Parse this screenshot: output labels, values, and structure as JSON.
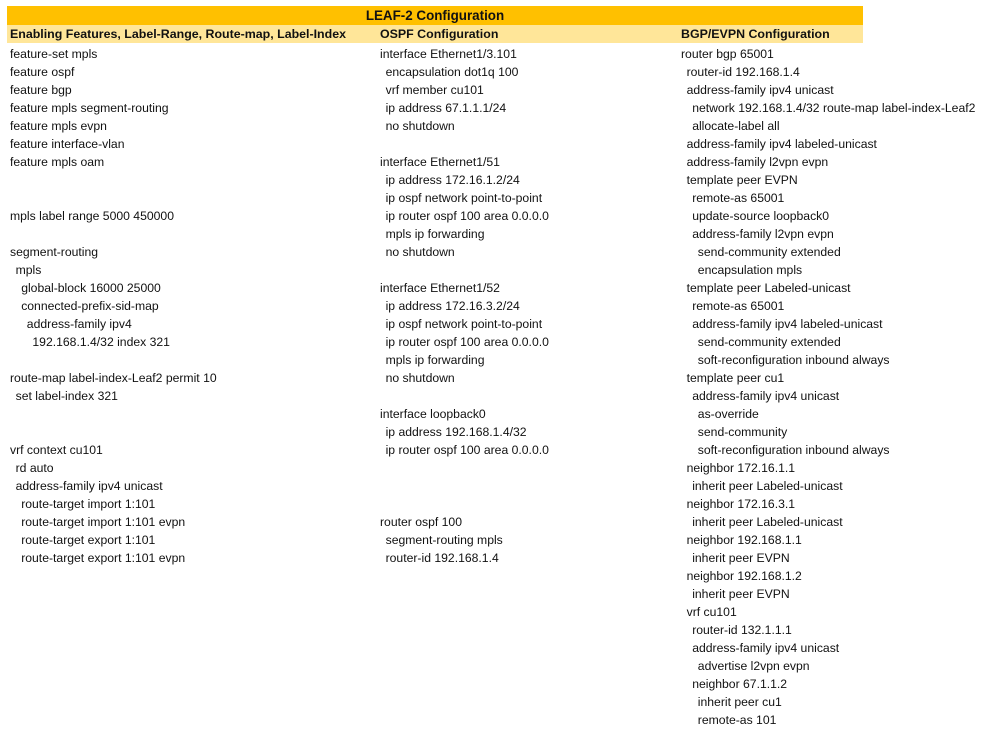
{
  "title": "LEAF-2 Configuration",
  "colors": {
    "title_bg": "#ffc000",
    "header_bg": "#ffe699"
  },
  "columns": [
    {
      "header": "Enabling Features, Label-Range, Route-map, Label-Index",
      "lines": [
        {
          "indent": 0,
          "text": "feature-set mpls"
        },
        {
          "indent": 0,
          "text": "feature ospf"
        },
        {
          "indent": 0,
          "text": "feature bgp"
        },
        {
          "indent": 0,
          "text": "feature mpls segment-routing"
        },
        {
          "indent": 0,
          "text": "feature mpls evpn"
        },
        {
          "indent": 0,
          "text": "feature interface-vlan"
        },
        {
          "indent": 0,
          "text": "feature mpls oam"
        },
        {
          "indent": 0,
          "text": ""
        },
        {
          "indent": 0,
          "text": ""
        },
        {
          "indent": 0,
          "text": "mpls label range 5000 450000"
        },
        {
          "indent": 0,
          "text": ""
        },
        {
          "indent": 0,
          "text": "segment-routing"
        },
        {
          "indent": 1,
          "text": "mpls"
        },
        {
          "indent": 2,
          "text": "global-block 16000 25000"
        },
        {
          "indent": 2,
          "text": "connected-prefix-sid-map"
        },
        {
          "indent": 3,
          "text": "address-family ipv4"
        },
        {
          "indent": 4,
          "text": "192.168.1.4/32 index 321"
        },
        {
          "indent": 0,
          "text": ""
        },
        {
          "indent": 0,
          "text": "route-map label-index-Leaf2 permit 10"
        },
        {
          "indent": 1,
          "text": "set label-index 321"
        },
        {
          "indent": 0,
          "text": ""
        },
        {
          "indent": 0,
          "text": ""
        },
        {
          "indent": 0,
          "text": "vrf context cu101"
        },
        {
          "indent": 1,
          "text": "rd auto"
        },
        {
          "indent": 1,
          "text": "address-family ipv4 unicast"
        },
        {
          "indent": 2,
          "text": "route-target import 1:101"
        },
        {
          "indent": 2,
          "text": "route-target import 1:101 evpn"
        },
        {
          "indent": 2,
          "text": "route-target export 1:101"
        },
        {
          "indent": 2,
          "text": "route-target export 1:101 evpn"
        }
      ]
    },
    {
      "header": "OSPF Configuration",
      "lines": [
        {
          "indent": 0,
          "text": "interface Ethernet1/3.101"
        },
        {
          "indent": 1,
          "text": "encapsulation dot1q 100"
        },
        {
          "indent": 1,
          "text": "vrf member cu101"
        },
        {
          "indent": 1,
          "text": "ip address 67.1.1.1/24"
        },
        {
          "indent": 1,
          "text": "no shutdown"
        },
        {
          "indent": 0,
          "text": ""
        },
        {
          "indent": 0,
          "text": "interface Ethernet1/51"
        },
        {
          "indent": 1,
          "text": "ip address 172.16.1.2/24"
        },
        {
          "indent": 1,
          "text": "ip ospf network point-to-point"
        },
        {
          "indent": 1,
          "text": "ip router ospf 100 area 0.0.0.0"
        },
        {
          "indent": 1,
          "text": "mpls ip forwarding"
        },
        {
          "indent": 1,
          "text": "no shutdown"
        },
        {
          "indent": 0,
          "text": ""
        },
        {
          "indent": 0,
          "text": "interface Ethernet1/52"
        },
        {
          "indent": 1,
          "text": "ip address 172.16.3.2/24"
        },
        {
          "indent": 1,
          "text": "ip ospf network point-to-point"
        },
        {
          "indent": 1,
          "text": "ip router ospf 100 area 0.0.0.0"
        },
        {
          "indent": 1,
          "text": "mpls ip forwarding"
        },
        {
          "indent": 1,
          "text": "no shutdown"
        },
        {
          "indent": 0,
          "text": ""
        },
        {
          "indent": 0,
          "text": "interface loopback0"
        },
        {
          "indent": 1,
          "text": "ip address 192.168.1.4/32"
        },
        {
          "indent": 1,
          "text": "ip router ospf 100 area 0.0.0.0"
        },
        {
          "indent": 0,
          "text": ""
        },
        {
          "indent": 0,
          "text": ""
        },
        {
          "indent": 0,
          "text": ""
        },
        {
          "indent": 0,
          "text": "router ospf 100"
        },
        {
          "indent": 1,
          "text": "segment-routing mpls"
        },
        {
          "indent": 1,
          "text": "router-id 192.168.1.4"
        }
      ]
    },
    {
      "header": "BGP/EVPN Configuration",
      "lines": [
        {
          "indent": 0,
          "text": "router bgp 65001"
        },
        {
          "indent": 1,
          "text": "router-id 192.168.1.4"
        },
        {
          "indent": 1,
          "text": "address-family ipv4 unicast"
        },
        {
          "indent": 2,
          "text": "network 192.168.1.4/32 route-map label-index-Leaf2"
        },
        {
          "indent": 2,
          "text": "allocate-label all"
        },
        {
          "indent": 1,
          "text": "address-family ipv4 labeled-unicast"
        },
        {
          "indent": 1,
          "text": "address-family l2vpn evpn"
        },
        {
          "indent": 1,
          "text": "template peer EVPN"
        },
        {
          "indent": 2,
          "text": "remote-as 65001"
        },
        {
          "indent": 2,
          "text": "update-source loopback0"
        },
        {
          "indent": 2,
          "text": "address-family l2vpn evpn"
        },
        {
          "indent": 3,
          "text": "send-community extended"
        },
        {
          "indent": 3,
          "text": "encapsulation mpls"
        },
        {
          "indent": 1,
          "text": "template peer Labeled-unicast"
        },
        {
          "indent": 2,
          "text": "remote-as 65001"
        },
        {
          "indent": 2,
          "text": "address-family ipv4 labeled-unicast"
        },
        {
          "indent": 3,
          "text": "send-community extended"
        },
        {
          "indent": 3,
          "text": "soft-reconfiguration inbound always"
        },
        {
          "indent": 1,
          "text": "template peer cu1"
        },
        {
          "indent": 2,
          "text": "address-family ipv4 unicast"
        },
        {
          "indent": 3,
          "text": "as-override"
        },
        {
          "indent": 3,
          "text": "send-community"
        },
        {
          "indent": 3,
          "text": "soft-reconfiguration inbound always"
        },
        {
          "indent": 1,
          "text": "neighbor 172.16.1.1"
        },
        {
          "indent": 2,
          "text": "inherit peer Labeled-unicast"
        },
        {
          "indent": 1,
          "text": "neighbor 172.16.3.1"
        },
        {
          "indent": 2,
          "text": "inherit peer Labeled-unicast"
        },
        {
          "indent": 1,
          "text": "neighbor 192.168.1.1"
        },
        {
          "indent": 2,
          "text": "inherit peer EVPN"
        },
        {
          "indent": 1,
          "text": "neighbor 192.168.1.2"
        },
        {
          "indent": 2,
          "text": "inherit peer EVPN"
        },
        {
          "indent": 1,
          "text": "vrf cu101"
        },
        {
          "indent": 2,
          "text": "router-id 132.1.1.1"
        },
        {
          "indent": 2,
          "text": "address-family ipv4 unicast"
        },
        {
          "indent": 3,
          "text": "advertise l2vpn evpn"
        },
        {
          "indent": 2,
          "text": "neighbor 67.1.1.2"
        },
        {
          "indent": 3,
          "text": "inherit peer cu1"
        },
        {
          "indent": 3,
          "text": "remote-as 101"
        }
      ]
    }
  ]
}
